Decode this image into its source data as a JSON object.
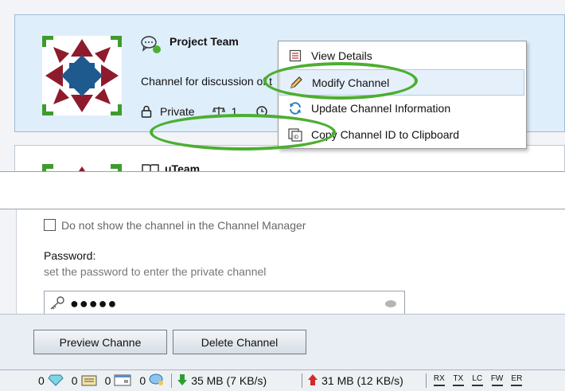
{
  "channels": [
    {
      "name": "Project Team",
      "description": "Channel for discussion of t",
      "privacy": "Private",
      "members": "1"
    },
    {
      "name": "uTeam"
    }
  ],
  "context_menu": {
    "items": [
      {
        "label": "View Details",
        "icon": "details-list-icon"
      },
      {
        "label": "Modify Channel",
        "icon": "pencil-icon"
      },
      {
        "label": "Update Channel Information",
        "icon": "refresh-icon"
      },
      {
        "label": "Copy Channel ID to Clipboard",
        "icon": "id-card-icon"
      }
    ]
  },
  "settings": {
    "hide_checkbox_label": "Do not show the channel in the Channel Manager",
    "hide_checked": false,
    "password_label": "Password:",
    "password_hint": "set the password to enter the private channel",
    "password_value": "●●●●●"
  },
  "buttons": {
    "preview": "Preview Channe",
    "delete": "Delete Channel"
  },
  "status_bar": {
    "diamond_count": "0",
    "contacts_count": "0",
    "cards_count": "0",
    "chat_count": "0",
    "download": "35 MB (7 KB/s)",
    "upload": "31 MB (12 KB/s)",
    "flags": [
      "RX",
      "TX",
      "LC",
      "FW",
      "ER"
    ]
  },
  "colors": {
    "highlight_green": "#4dae32",
    "selected_card": "#dfeefb",
    "logo_red": "#8e1b2c",
    "logo_blue": "#1f5a8f",
    "logo_green": "#3f9b2f"
  }
}
